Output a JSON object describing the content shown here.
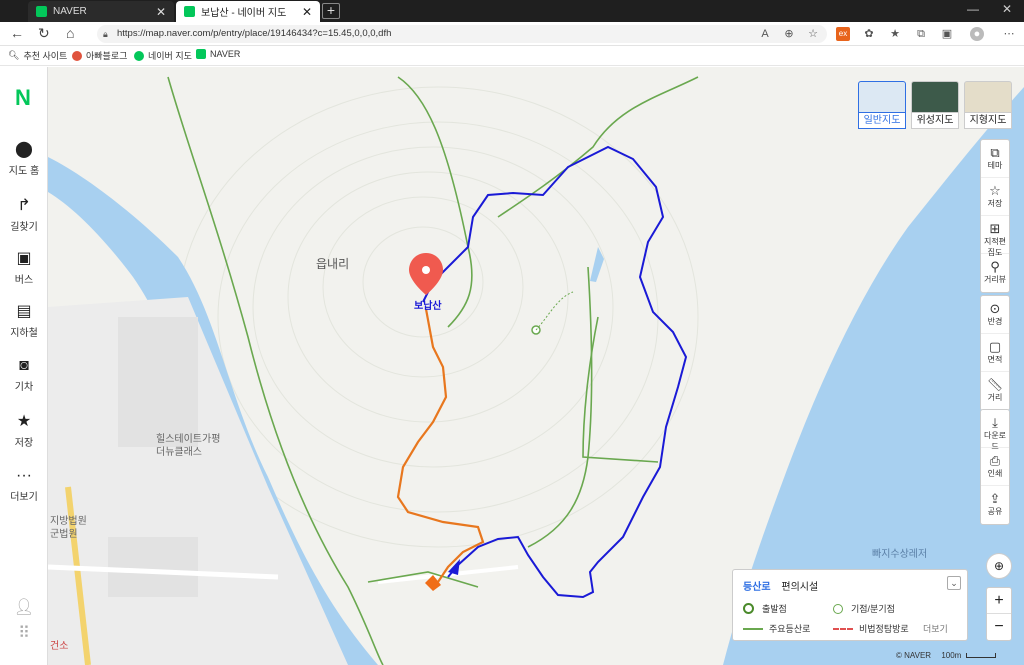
{
  "browser": {
    "tabs": [
      {
        "title": "NAVER",
        "favicon_color": "#03c75a"
      },
      {
        "title": "보납산 - 네이버 지도",
        "favicon_color": "#03c75a"
      }
    ],
    "new_tab": "+",
    "url": "https://map.naver.com/p/entry/place/19146434?c=15.45,0,0,0,dfh",
    "bookmarks": [
      {
        "label": "추천 사이트",
        "color": "#777777"
      },
      {
        "label": "아빠블로그",
        "color": "#e0533d"
      },
      {
        "label": "네이버 지도",
        "color": "#03c75a"
      },
      {
        "label": "NAVER",
        "color": "#03c75a"
      }
    ]
  },
  "sidebar": {
    "logo": "N",
    "items": [
      {
        "label": "지도 홈",
        "icon": "pin-icon"
      },
      {
        "label": "길찾기",
        "icon": "directions-icon"
      },
      {
        "label": "버스",
        "icon": "bus-icon"
      },
      {
        "label": "지하철",
        "icon": "subway-icon"
      },
      {
        "label": "기차",
        "icon": "train-icon"
      },
      {
        "label": "저장",
        "icon": "star-icon"
      },
      {
        "label": "더보기",
        "icon": "more-icon"
      }
    ]
  },
  "map": {
    "labels": {
      "area": "읍내리",
      "peak": "보납산",
      "building": "힐스테이트가평\n더뉴클래스",
      "court": "지방법원\n군법원",
      "leisure": "빠지수상레저",
      "building2": "건소"
    },
    "map_types": [
      {
        "label": "일반지도",
        "active": true
      },
      {
        "label": "위성지도",
        "active": false
      },
      {
        "label": "지형지도",
        "active": false
      }
    ],
    "tools": [
      {
        "label": "테마",
        "icon": "layers-icon"
      },
      {
        "label": "저장",
        "icon": "star-icon"
      },
      {
        "label": "지적편집도",
        "icon": "cadastral-icon"
      },
      {
        "label": "거리뷰",
        "icon": "streetview-icon"
      },
      {
        "label": "반경",
        "icon": "radius-icon"
      },
      {
        "label": "면적",
        "icon": "area-icon"
      },
      {
        "label": "거리",
        "icon": "ruler-icon"
      },
      {
        "label": "다운로드",
        "icon": "download-icon"
      },
      {
        "label": "인쇄",
        "icon": "print-icon"
      },
      {
        "label": "공유",
        "icon": "share-icon"
      }
    ],
    "legend": {
      "tab_trails": "등산로",
      "tab_facilities": "편의시설",
      "start_point": "출발점",
      "junction": "기점/분기점",
      "main_trail": "주요등산로",
      "illegal_trail": "비법정탐방로",
      "more": "더보기"
    },
    "zoom": {
      "in": "+",
      "out": "−"
    },
    "attribution": "© NAVER",
    "scale": "100m",
    "colors": {
      "water": "#a8d0f0",
      "trail": "#6aa84f",
      "route_blue": "#1a1ad6",
      "route_orange": "#e8771e",
      "marker": "#f05a4f"
    }
  }
}
